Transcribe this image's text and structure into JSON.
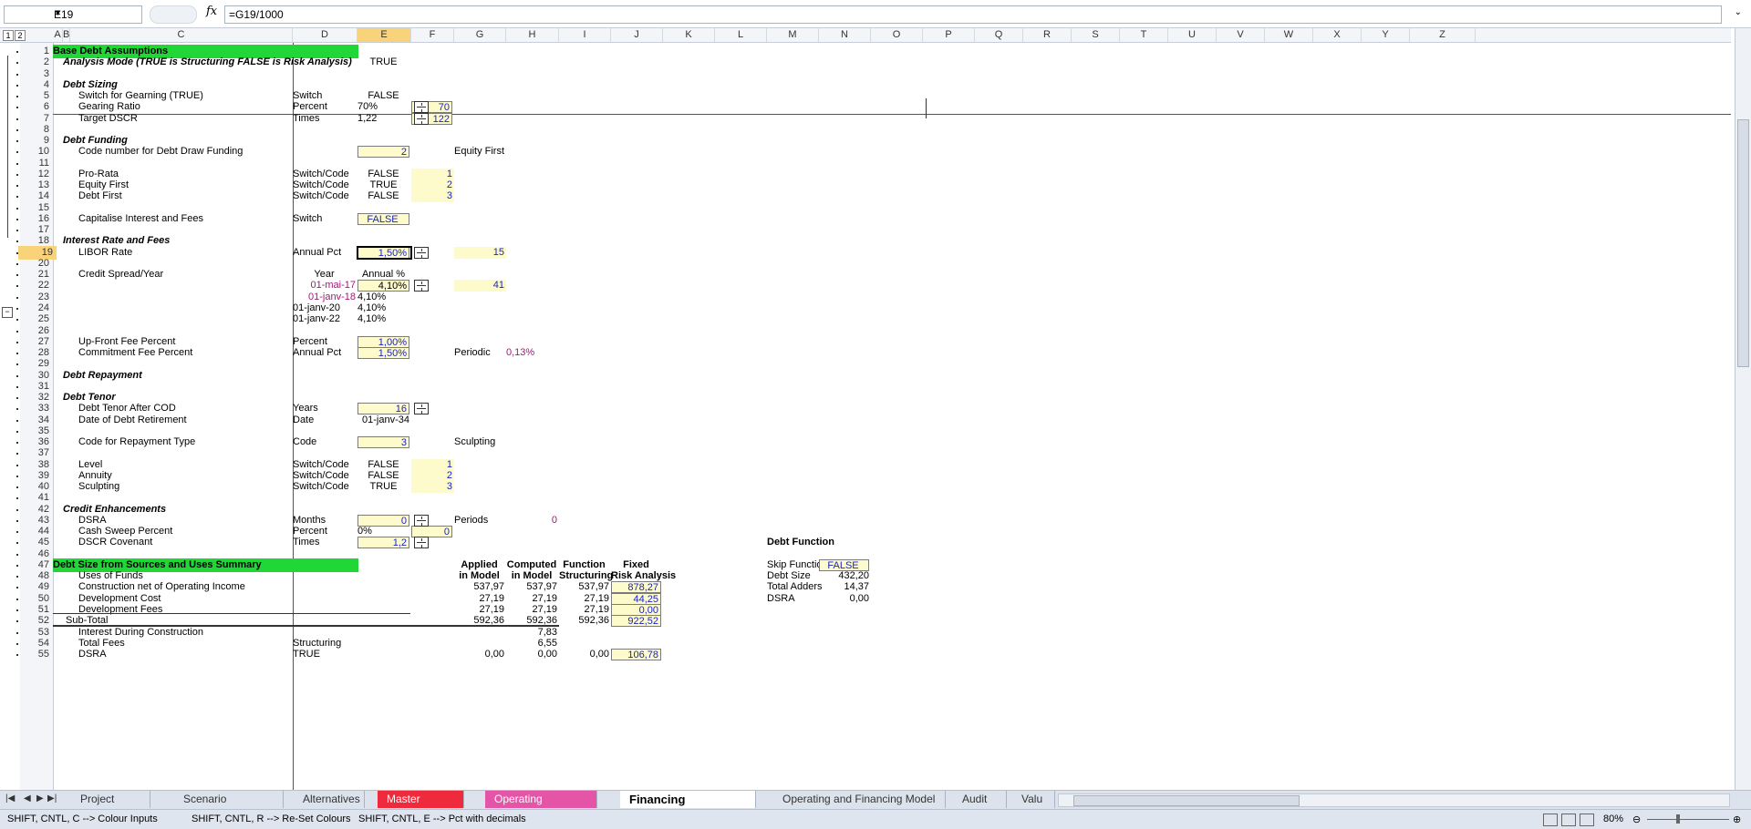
{
  "formula_bar": {
    "name_box": "E19",
    "fx": "fx",
    "formula": "=G19/1000"
  },
  "outline_levels": [
    "1",
    "2"
  ],
  "columns": [
    "A",
    "B",
    "C",
    "D",
    "E",
    "F",
    "G",
    "H",
    "I",
    "J",
    "K",
    "L",
    "M",
    "N",
    "O",
    "P",
    "Q",
    "R",
    "S",
    "T",
    "U",
    "V",
    "W",
    "X",
    "Y",
    "Z"
  ],
  "rows": [
    "1",
    "2",
    "3",
    "4",
    "5",
    "6",
    "7",
    "8",
    "9",
    "10",
    "11",
    "12",
    "13",
    "14",
    "15",
    "16",
    "17",
    "18",
    "19",
    "20",
    "21",
    "22",
    "23",
    "24",
    "25",
    "26",
    "27",
    "28",
    "29",
    "30",
    "31",
    "32",
    "33",
    "34",
    "35",
    "36",
    "37",
    "38",
    "39",
    "40",
    "41",
    "42",
    "43",
    "44",
    "45",
    "46",
    "47",
    "48",
    "49",
    "50",
    "51",
    "52",
    "53",
    "54",
    "55"
  ],
  "cells": {
    "r1_b": "Base Debt Assumptions",
    "r2_b": "Analysis Mode (TRUE is Structuring FALSE is Risk Analysis)",
    "r2_e": "TRUE",
    "r4_b": "Debt Sizing",
    "r5_c": "Switch for Gearning (TRUE)",
    "r5_d": "Switch",
    "r5_e": "FALSE",
    "r6_c": "Gearing Ratio",
    "r6_d": "Percent",
    "r6_e": "70%",
    "r6_f": "70",
    "r7_c": "Target DSCR",
    "r7_d": "Times",
    "r7_e": "1,22",
    "r7_f": "122",
    "r9_b": "Debt Funding",
    "r10_c": "Code number for Debt Draw Funding",
    "r10_e": "2",
    "r10_g": "Equity First",
    "r12_c": "Pro-Rata",
    "r12_d": "Switch/Code",
    "r12_e": "FALSE",
    "r12_f": "1",
    "r13_c": "Equity First",
    "r13_d": "Switch/Code",
    "r13_e": "TRUE",
    "r13_f": "2",
    "r14_c": "Debt First",
    "r14_d": "Switch/Code",
    "r14_e": "FALSE",
    "r14_f": "3",
    "r16_c": "Capitalise Interest and Fees",
    "r16_d": "Switch",
    "r16_e": "FALSE",
    "r18_b": "Interest Rate and Fees",
    "r19_c": "LIBOR Rate",
    "r19_d": "Annual Pct",
    "r19_e": "1,50%",
    "r19_g": "15",
    "r21_c": "Credit Spread/Year",
    "r21_d": "Year",
    "r21_e": "Annual %",
    "r22_d": "01-mai-17",
    "r22_e": "4,10%",
    "r22_g": "41",
    "r23_d": "01-janv-18",
    "r23_e": "4,10%",
    "r24_d": "01-janv-20",
    "r24_e": "4,10%",
    "r25_d": "01-janv-22",
    "r25_e": "4,10%",
    "r27_c": "Up-Front Fee Percent",
    "r27_d": "Percent",
    "r27_e": "1,00%",
    "r28_c": "Commitment Fee Percent",
    "r28_d": "Annual Pct",
    "r28_e": "1,50%",
    "r28_g": "Periodic",
    "r28_h": "0,13%",
    "r30_b": "Debt Repayment",
    "r32_b": "Debt Tenor",
    "r33_c": "Debt Tenor After COD",
    "r33_d": "Years",
    "r33_e": "16",
    "r34_c": "Date of Debt Retirement",
    "r34_d": "Date",
    "r34_e": "01-janv-34",
    "r36_c": "Code for Repayment Type",
    "r36_d": "Code",
    "r36_e": "3",
    "r36_g": "Sculpting",
    "r38_c": "Level",
    "r38_d": "Switch/Code",
    "r38_e": "FALSE",
    "r38_f": "1",
    "r39_c": "Annuity",
    "r39_d": "Switch/Code",
    "r39_e": "FALSE",
    "r39_f": "2",
    "r40_c": "Sculpting",
    "r40_d": "Switch/Code",
    "r40_e": "TRUE",
    "r40_f": "3",
    "r42_b": "Credit Enhancements",
    "r43_c": "DSRA",
    "r43_d": "Months",
    "r43_e": "0",
    "r43_g": "Periods",
    "r43_h": "0",
    "r44_c": "Cash Sweep Percent",
    "r44_d": "Percent",
    "r44_e": "0%",
    "r44_f": "0",
    "r45_c": "DSCR Covenant",
    "r45_d": "Times",
    "r45_e": "1,2",
    "r45_m": "Debt Function",
    "r47_b": "Debt Size from Sources and Uses Summary",
    "r47_g": "Applied",
    "r47_h": "Computed",
    "r47_i": "Function",
    "r47_j": "Fixed",
    "r47_m": "Skip Functio",
    "r47_n": "FALSE",
    "r48_c": "Uses of Funds",
    "r48_g": "in Model",
    "r48_h": "in Model",
    "r48_i": "Structuring",
    "r48_j": "Risk Analysis",
    "r48_m": "Debt Size",
    "r48_n": "432,20",
    "r49_c": "Construction net of Operating Income",
    "r49_g": "537,97",
    "r49_h": "537,97",
    "r49_i": "537,97",
    "r49_j": "878,27",
    "r49_m": "Total Adders",
    "r49_n": "14,37",
    "r50_c": "Development Cost",
    "r50_g": "27,19",
    "r50_h": "27,19",
    "r50_i": "27,19",
    "r50_j": "44,25",
    "r50_m": "DSRA",
    "r50_n": "0,00",
    "r51_c": "Development Fees",
    "r51_g": "27,19",
    "r51_h": "27,19",
    "r51_i": "27,19",
    "r51_j": "0,00",
    "r52_c": "Sub-Total",
    "r52_g": "592,36",
    "r52_h": "592,36",
    "r52_i": "592,36",
    "r52_j": "922,52",
    "r53_c": "Interest During Construction",
    "r53_h": "7,83",
    "r54_c": "Total Fees",
    "r54_d": "Structuring",
    "r54_h": "6,55",
    "r55_c": "DSRA",
    "r55_d": "TRUE",
    "r55_g": "0,00",
    "r55_h": "0,00",
    "r55_i": "0,00",
    "r55_j": "106,78"
  },
  "sheet_tabs": [
    "Project Diagram",
    "Scenario Tabulation",
    "Alternatives",
    "Master Scenario",
    "Operating Assumptions",
    "Financing Assumptions",
    "Operating and Financing Model",
    "Audit",
    "Valu"
  ],
  "active_tab": "Financing Assumptions",
  "status_bar": {
    "hint1": "SHIFT, CNTL, C --> Colour Inputs",
    "hint2": "SHIFT, CNTL, R --> Re-Set Colours",
    "hint3": "SHIFT, CNTL, E --> Pct with decimals",
    "zoom": "80%"
  },
  "colors": {
    "section_header": "#21d637",
    "input_cell": "#fdfacc",
    "red_tab": "#ee2a3c",
    "pink_tab": "#e455a8",
    "link_blue": "#1a23c8",
    "magenta_text": "#a0197a"
  },
  "icons": [
    "dropdown-arrow-icon",
    "function-icon",
    "spin-button-icon",
    "page-layout-icon",
    "zoom-minus-icon",
    "zoom-plus-icon"
  ]
}
